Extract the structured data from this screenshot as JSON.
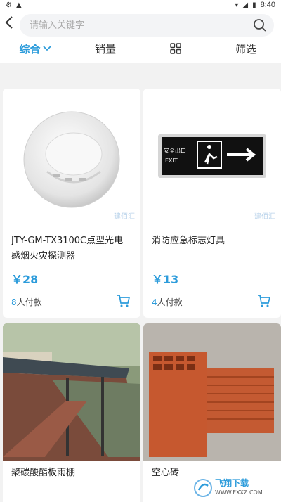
{
  "status": {
    "time": "8:40"
  },
  "search": {
    "placeholder": "请输入关键字"
  },
  "sort_tabs": [
    {
      "label": "综合",
      "active": true
    },
    {
      "label": "销量",
      "active": false
    },
    {
      "label": "",
      "icon": "grid-view-icon"
    },
    {
      "label": "筛选",
      "active": false
    }
  ],
  "products": [
    {
      "title": "JTY-GM-TX3100C点型光电感烟火灾探测器",
      "price": "￥28",
      "sold_count": "8",
      "sold_suffix": "人付款",
      "watermark": "建佰汇"
    },
    {
      "title": "消防应急标志灯具",
      "price": "￥13",
      "sold_count": "4",
      "sold_suffix": "人付款",
      "watermark": "建佰汇",
      "sign_text_cn": "安全出口",
      "sign_text_en": "EXIT"
    },
    {
      "title": "聚碳酸酯板雨棚",
      "price": "",
      "sold_count": "",
      "sold_suffix": ""
    },
    {
      "title": "空心砖",
      "price": "",
      "sold_count": "",
      "sold_suffix": ""
    }
  ],
  "badge": {
    "text_cn": "飞翔下载",
    "text_en": "WWW.FXXZ.COM"
  },
  "colors": {
    "accent": "#2d9cdb",
    "background": "#f2f2f2"
  }
}
